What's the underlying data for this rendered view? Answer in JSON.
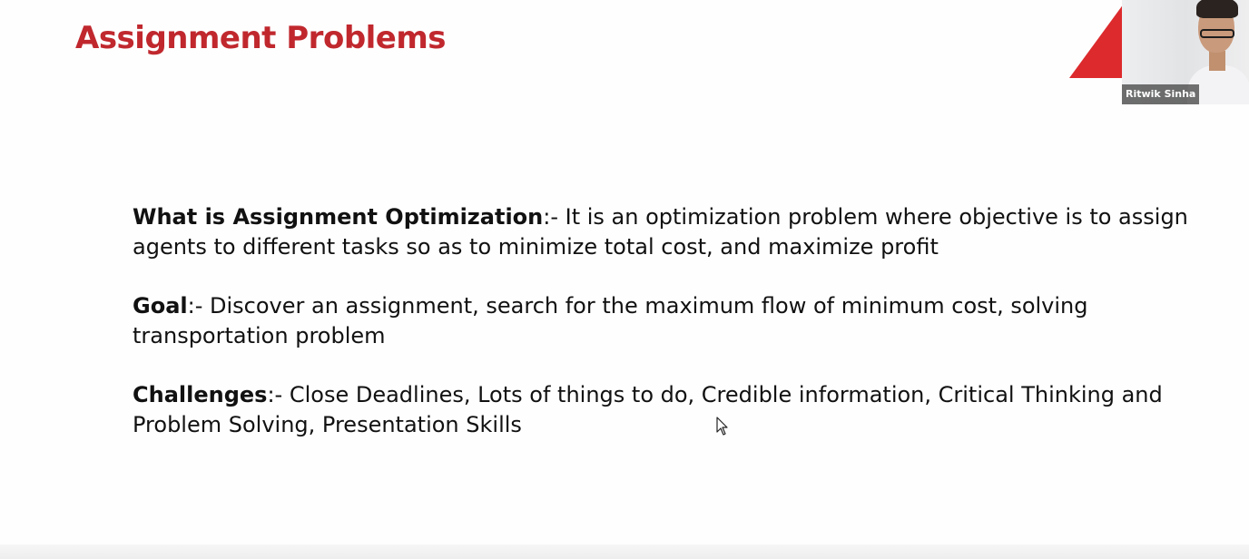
{
  "slide": {
    "title": "Assignment Problems",
    "accent_color": "#c0282e",
    "paragraphs": [
      {
        "term": "What is Assignment Optimization",
        "text": ":- It is an optimization problem where objective is to assign agents to different tasks so as to minimize total cost, and maximize profit"
      },
      {
        "term": "Goal",
        "text": ":- Discover an assignment, search for the maximum flow of minimum cost, solving transportation problem"
      },
      {
        "term": "Challenges",
        "text": ":- Close Deadlines, Lots of things to do, Credible information, Critical Thinking and Problem Solving, Presentation Skills"
      }
    ]
  },
  "video": {
    "participant_name": "Ritwik Sinha"
  },
  "cursor": {
    "icon": "mouse-pointer-icon"
  }
}
